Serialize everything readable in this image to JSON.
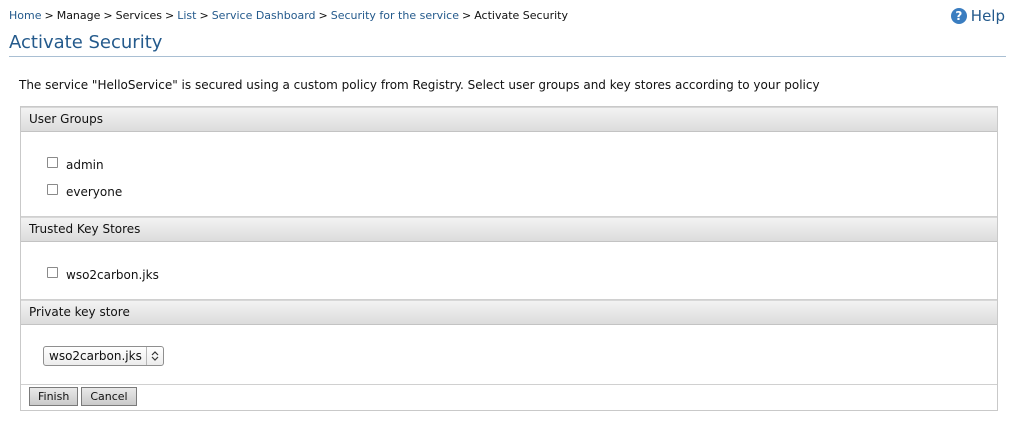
{
  "breadcrumb": {
    "home": "Home",
    "manage": "Manage",
    "services": "Services",
    "list": "List",
    "dashboard": "Service Dashboard",
    "security": "Security for the service",
    "current": "Activate Security",
    "separator": ">"
  },
  "help": {
    "label": "Help",
    "icon": "?"
  },
  "page_title": "Activate Security",
  "intro": "The service \"HelloService\" is secured using a custom policy from Registry. Select user groups and key stores according to your policy",
  "sections": {
    "user_groups": {
      "title": "User Groups",
      "items": [
        {
          "label": "admin",
          "checked": false
        },
        {
          "label": "everyone",
          "checked": false
        }
      ]
    },
    "trusted_key_stores": {
      "title": "Trusted Key Stores",
      "items": [
        {
          "label": "wso2carbon.jks",
          "checked": false
        }
      ]
    },
    "private_key_store": {
      "title": "Private key store",
      "selected": "wso2carbon.jks"
    }
  },
  "buttons": {
    "finish": "Finish",
    "cancel": "Cancel"
  },
  "colors": {
    "link": "#245a8c",
    "title": "#245a8c",
    "header_bg": "#e4e4e4"
  }
}
